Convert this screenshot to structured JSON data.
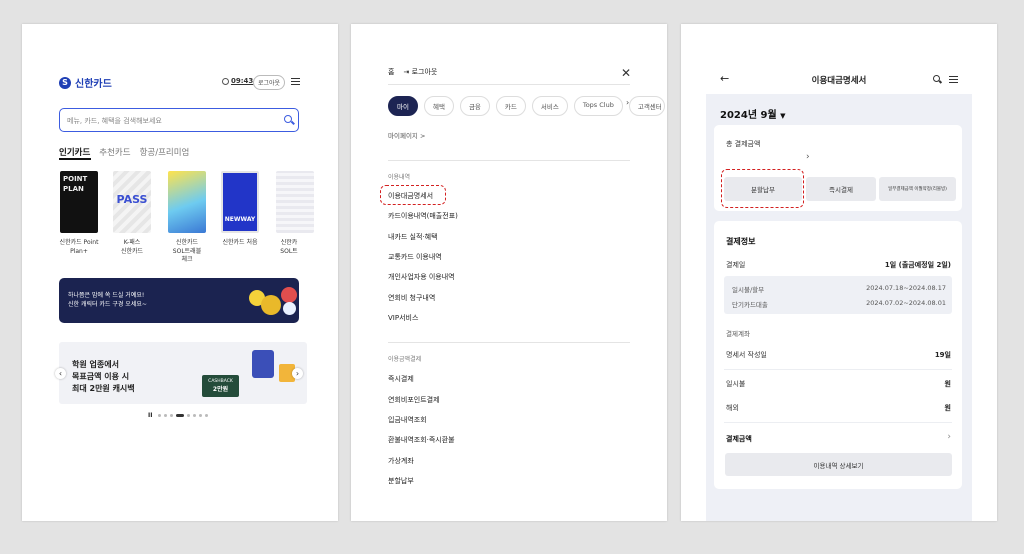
{
  "panel1": {
    "logo_text": "신한카드",
    "time": "09:43",
    "logout": "로그아웃",
    "search_placeholder": "메뉴, 카드, 혜택을 검색해보세요",
    "tabs": [
      "인기카드",
      "추천카드",
      "항공/프리미엄"
    ],
    "cards": [
      {
        "art": "POINT PLAN",
        "caption": [
          "신한카드 Point",
          "Plan+"
        ]
      },
      {
        "art": "PASS",
        "caption": [
          "K-패스",
          "신한카드"
        ]
      },
      {
        "art": "",
        "caption": [
          "신한카드",
          "SOL트래블",
          "체크"
        ]
      },
      {
        "art": "NEWWAY",
        "caption": [
          "신한카드 처음"
        ]
      },
      {
        "art": "",
        "caption": [
          "신한카",
          "SOL트"
        ]
      }
    ],
    "banner1": [
      "하나쯤은 맘에 쏙 드실 거예요!",
      "신한 캐릭터 카드 구경 오세요~"
    ],
    "banner2": [
      "학원 업종에서",
      "목표금액 이용 시",
      "최대 2만원 캐시백"
    ],
    "banner2_art": [
      "CASHBACK",
      "2만원"
    ],
    "pause": "II"
  },
  "panel2": {
    "home": "홈",
    "logout": "로그아웃",
    "chips": [
      "마이",
      "혜택",
      "금융",
      "카드",
      "서비스",
      "Tops Club",
      "고객센터"
    ],
    "mypage": "마이페이지 >",
    "section1": "이용내역",
    "section1_items": [
      "이용대금명세서",
      "카드이용내역(매출전표)",
      "내카드 실적·혜택",
      "교통카드 이용내역",
      "개인사업자용 이용내역",
      "연회비 청구내역",
      "VIP서비스"
    ],
    "section2": "이용금액결제",
    "section2_items": [
      "즉시결제",
      "연회비포인트결제",
      "입금내역조회",
      "환불내역조회·즉시환불",
      "가상계좌",
      "분할납부"
    ]
  },
  "panel3": {
    "title": "이용대금명세서",
    "month": "2024년 9월",
    "total_label": "총 결제금액",
    "buttons": [
      "분할납부",
      "즉시결제",
      "일부결제금액 이월약정(리볼빙)"
    ],
    "info_title": "결제정보",
    "pay_day_label": "결제일",
    "pay_day_value": "1일 (출금예정일 2일)",
    "sub_rows": [
      {
        "label": "일시불/할부",
        "value": "2024.07.18~2024.08.17"
      },
      {
        "label": "단기카드대출",
        "value": "2024.07.02~2024.08.01"
      }
    ],
    "account_label": "결제계좌",
    "statement_label": "명세서 작성일",
    "statement_value": "19일",
    "lump_label": "일시불",
    "lump_value": "원",
    "overseas_label": "해외",
    "overseas_value": "원",
    "amount_label": "결제금액",
    "detail_button": "이용내역 상세보기"
  },
  "colors": {
    "brand": "#1f3fb5",
    "navy": "#1d2453",
    "highlight": "#d32020"
  }
}
